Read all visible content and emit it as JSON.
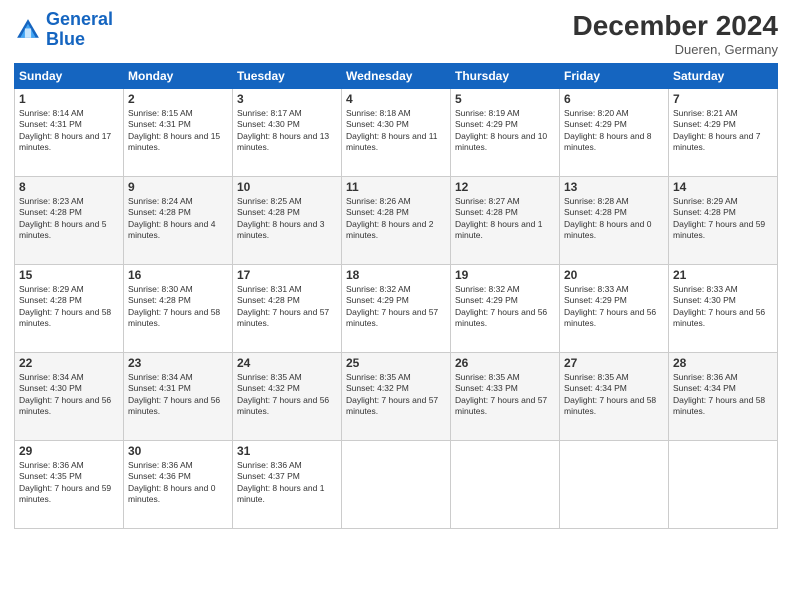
{
  "header": {
    "logo_line1": "General",
    "logo_line2": "Blue",
    "month": "December 2024",
    "location": "Dueren, Germany"
  },
  "weekdays": [
    "Sunday",
    "Monday",
    "Tuesday",
    "Wednesday",
    "Thursday",
    "Friday",
    "Saturday"
  ],
  "weeks": [
    [
      {
        "day": "1",
        "sunrise": "Sunrise: 8:14 AM",
        "sunset": "Sunset: 4:31 PM",
        "daylight": "Daylight: 8 hours and 17 minutes."
      },
      {
        "day": "2",
        "sunrise": "Sunrise: 8:15 AM",
        "sunset": "Sunset: 4:31 PM",
        "daylight": "Daylight: 8 hours and 15 minutes."
      },
      {
        "day": "3",
        "sunrise": "Sunrise: 8:17 AM",
        "sunset": "Sunset: 4:30 PM",
        "daylight": "Daylight: 8 hours and 13 minutes."
      },
      {
        "day": "4",
        "sunrise": "Sunrise: 8:18 AM",
        "sunset": "Sunset: 4:30 PM",
        "daylight": "Daylight: 8 hours and 11 minutes."
      },
      {
        "day": "5",
        "sunrise": "Sunrise: 8:19 AM",
        "sunset": "Sunset: 4:29 PM",
        "daylight": "Daylight: 8 hours and 10 minutes."
      },
      {
        "day": "6",
        "sunrise": "Sunrise: 8:20 AM",
        "sunset": "Sunset: 4:29 PM",
        "daylight": "Daylight: 8 hours and 8 minutes."
      },
      {
        "day": "7",
        "sunrise": "Sunrise: 8:21 AM",
        "sunset": "Sunset: 4:29 PM",
        "daylight": "Daylight: 8 hours and 7 minutes."
      }
    ],
    [
      {
        "day": "8",
        "sunrise": "Sunrise: 8:23 AM",
        "sunset": "Sunset: 4:28 PM",
        "daylight": "Daylight: 8 hours and 5 minutes."
      },
      {
        "day": "9",
        "sunrise": "Sunrise: 8:24 AM",
        "sunset": "Sunset: 4:28 PM",
        "daylight": "Daylight: 8 hours and 4 minutes."
      },
      {
        "day": "10",
        "sunrise": "Sunrise: 8:25 AM",
        "sunset": "Sunset: 4:28 PM",
        "daylight": "Daylight: 8 hours and 3 minutes."
      },
      {
        "day": "11",
        "sunrise": "Sunrise: 8:26 AM",
        "sunset": "Sunset: 4:28 PM",
        "daylight": "Daylight: 8 hours and 2 minutes."
      },
      {
        "day": "12",
        "sunrise": "Sunrise: 8:27 AM",
        "sunset": "Sunset: 4:28 PM",
        "daylight": "Daylight: 8 hours and 1 minute."
      },
      {
        "day": "13",
        "sunrise": "Sunrise: 8:28 AM",
        "sunset": "Sunset: 4:28 PM",
        "daylight": "Daylight: 8 hours and 0 minutes."
      },
      {
        "day": "14",
        "sunrise": "Sunrise: 8:29 AM",
        "sunset": "Sunset: 4:28 PM",
        "daylight": "Daylight: 7 hours and 59 minutes."
      }
    ],
    [
      {
        "day": "15",
        "sunrise": "Sunrise: 8:29 AM",
        "sunset": "Sunset: 4:28 PM",
        "daylight": "Daylight: 7 hours and 58 minutes."
      },
      {
        "day": "16",
        "sunrise": "Sunrise: 8:30 AM",
        "sunset": "Sunset: 4:28 PM",
        "daylight": "Daylight: 7 hours and 58 minutes."
      },
      {
        "day": "17",
        "sunrise": "Sunrise: 8:31 AM",
        "sunset": "Sunset: 4:28 PM",
        "daylight": "Daylight: 7 hours and 57 minutes."
      },
      {
        "day": "18",
        "sunrise": "Sunrise: 8:32 AM",
        "sunset": "Sunset: 4:29 PM",
        "daylight": "Daylight: 7 hours and 57 minutes."
      },
      {
        "day": "19",
        "sunrise": "Sunrise: 8:32 AM",
        "sunset": "Sunset: 4:29 PM",
        "daylight": "Daylight: 7 hours and 56 minutes."
      },
      {
        "day": "20",
        "sunrise": "Sunrise: 8:33 AM",
        "sunset": "Sunset: 4:29 PM",
        "daylight": "Daylight: 7 hours and 56 minutes."
      },
      {
        "day": "21",
        "sunrise": "Sunrise: 8:33 AM",
        "sunset": "Sunset: 4:30 PM",
        "daylight": "Daylight: 7 hours and 56 minutes."
      }
    ],
    [
      {
        "day": "22",
        "sunrise": "Sunrise: 8:34 AM",
        "sunset": "Sunset: 4:30 PM",
        "daylight": "Daylight: 7 hours and 56 minutes."
      },
      {
        "day": "23",
        "sunrise": "Sunrise: 8:34 AM",
        "sunset": "Sunset: 4:31 PM",
        "daylight": "Daylight: 7 hours and 56 minutes."
      },
      {
        "day": "24",
        "sunrise": "Sunrise: 8:35 AM",
        "sunset": "Sunset: 4:32 PM",
        "daylight": "Daylight: 7 hours and 56 minutes."
      },
      {
        "day": "25",
        "sunrise": "Sunrise: 8:35 AM",
        "sunset": "Sunset: 4:32 PM",
        "daylight": "Daylight: 7 hours and 57 minutes."
      },
      {
        "day": "26",
        "sunrise": "Sunrise: 8:35 AM",
        "sunset": "Sunset: 4:33 PM",
        "daylight": "Daylight: 7 hours and 57 minutes."
      },
      {
        "day": "27",
        "sunrise": "Sunrise: 8:35 AM",
        "sunset": "Sunset: 4:34 PM",
        "daylight": "Daylight: 7 hours and 58 minutes."
      },
      {
        "day": "28",
        "sunrise": "Sunrise: 8:36 AM",
        "sunset": "Sunset: 4:34 PM",
        "daylight": "Daylight: 7 hours and 58 minutes."
      }
    ],
    [
      {
        "day": "29",
        "sunrise": "Sunrise: 8:36 AM",
        "sunset": "Sunset: 4:35 PM",
        "daylight": "Daylight: 7 hours and 59 minutes."
      },
      {
        "day": "30",
        "sunrise": "Sunrise: 8:36 AM",
        "sunset": "Sunset: 4:36 PM",
        "daylight": "Daylight: 8 hours and 0 minutes."
      },
      {
        "day": "31",
        "sunrise": "Sunrise: 8:36 AM",
        "sunset": "Sunset: 4:37 PM",
        "daylight": "Daylight: 8 hours and 1 minute."
      },
      null,
      null,
      null,
      null
    ]
  ]
}
